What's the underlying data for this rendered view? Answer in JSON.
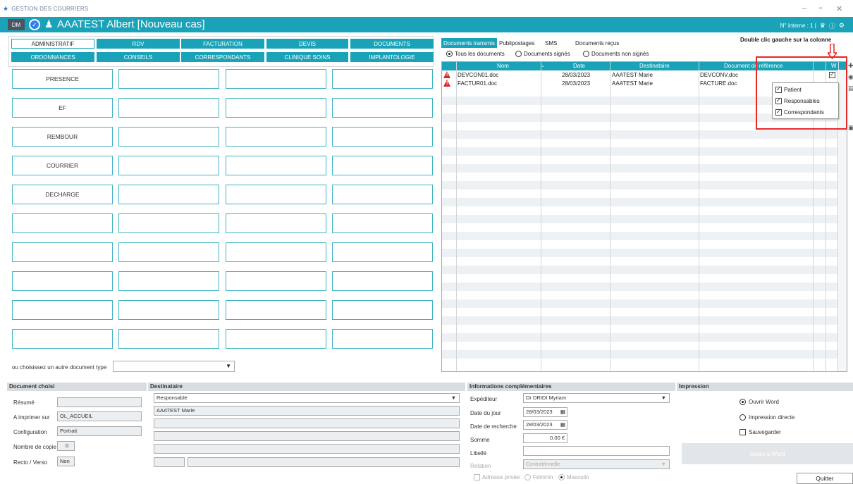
{
  "window": {
    "title": "GESTION DES COURRIERS",
    "min_glyph": "–",
    "restore_glyph": "▫",
    "close_glyph": "✕"
  },
  "header": {
    "badge": "DM",
    "patient": "AAATEST Albert  [Nouveau cas]",
    "internal_no": "N° interne : 1  |",
    "bg_color": "#1aa3b8"
  },
  "tabs_row1": [
    "ADMINISTRATIF",
    "RDV",
    "FACTURATION",
    "DEVIS",
    "DOCUMENTS"
  ],
  "tabs_row2": [
    "ORDONNANCES",
    "CONSEILS",
    "CORRESPONDANTS",
    "CLINIQUE SOINS",
    "IMPLANTOLOGIE"
  ],
  "doc_cells": [
    "PRESENCE",
    "EF",
    "REMBOUR",
    "COURRIER",
    "DECHARGE"
  ],
  "other_doc_label": "ou choisissez un autre document type",
  "right_tabs": [
    "Documents transmis",
    "Publipostages",
    "SMS",
    "Documents reçus"
  ],
  "filters": [
    "Tous les documents",
    "Documents signés",
    "Documents non signés"
  ],
  "grid": {
    "headers": [
      "Nom",
      "Date",
      "Destinataire",
      "Document de référence",
      "W"
    ],
    "rows": [
      {
        "nom": "DEVCON01.doc",
        "date": "28/03/2023",
        "dest": "AAATEST Marie",
        "ref": "DEVCONV.doc"
      },
      {
        "nom": "FACTUR01.doc",
        "date": "28/03/2023",
        "dest": "AAATEST Marie",
        "ref": "FACTURE.doc"
      }
    ]
  },
  "annotation": "Double clic gauche sur la colonne",
  "popup_items": [
    "Patient",
    "Responsables",
    "Correspondants"
  ],
  "sections": {
    "document_choisi": "Document choisi",
    "destinataire": "Destinataire",
    "infos": "Informations complémentaires",
    "impression": "Impression"
  },
  "doc_choisi": {
    "resume_label": "Résumé",
    "resume_value": "",
    "imprimer_label": "A imprimer sur",
    "imprimer_value": "OL_ACCUEIL",
    "config_label": "Configuration",
    "config_value": "Portrait",
    "copies_label": "Nombre de copie",
    "copies_value": "0",
    "recto_label": "Recto / Verso",
    "recto_value": "Non"
  },
  "destinataire": {
    "type": "Responsable",
    "name": "AAATEST Marie"
  },
  "infos": {
    "expediteur_label": "Expéditeur",
    "expediteur_value": "Dr DRIDI Myriam",
    "date_jour_label": "Date du jour",
    "date_jour_value": "28/03/2023",
    "date_recherche_label": "Date de recherche",
    "date_recherche_value": "28/03/2023",
    "somme_label": "Somme",
    "somme_value": "0.00 €",
    "libelle_label": "Libellé",
    "libelle_value": "",
    "relation_label": "Relation",
    "relation_value": "Contrat/emelle",
    "adresse_privee": "Adresse privée",
    "feminin": "Féminin",
    "masculin": "Masculin"
  },
  "impression": {
    "ouvrir_word": "Ouvrir Word",
    "impression_directe": "Impression directe",
    "sauvegarder": "Sauvegarder",
    "acces_word": "Accès à Word"
  },
  "quit_label": "Quitter"
}
